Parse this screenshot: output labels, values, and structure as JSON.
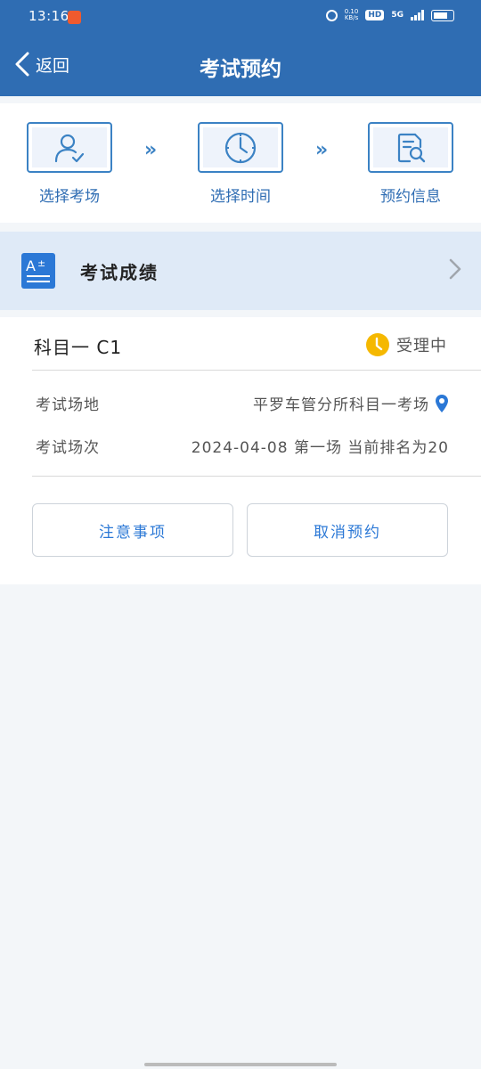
{
  "status_bar": {
    "time": "13:16",
    "network_speed_top": "0.10",
    "network_speed_bottom": "KB/s",
    "hd_label": "HD",
    "signal_label": "5G"
  },
  "header": {
    "back_label": "返回",
    "title": "考试预约",
    "bg_color": "#2f6db3"
  },
  "steps": [
    {
      "label": "选择考场",
      "icon": "user-check-icon"
    },
    {
      "label": "选择时间",
      "icon": "clock-icon"
    },
    {
      "label": "预约信息",
      "icon": "document-search-icon"
    }
  ],
  "score": {
    "label": "考试成绩",
    "icon": "grade-icon"
  },
  "booking": {
    "subject": "科目一 C1",
    "status": "受理中",
    "venue_label": "考试场地",
    "venue_value": "平罗车管分所科目一考场",
    "session_label": "考试场次",
    "session_value": "2024-04-08 第一场 当前排名为20",
    "notice_button": "注意事项",
    "cancel_button": "取消预约"
  },
  "colors": {
    "accent": "#2b78d6",
    "status_pending": "#f5b800"
  }
}
